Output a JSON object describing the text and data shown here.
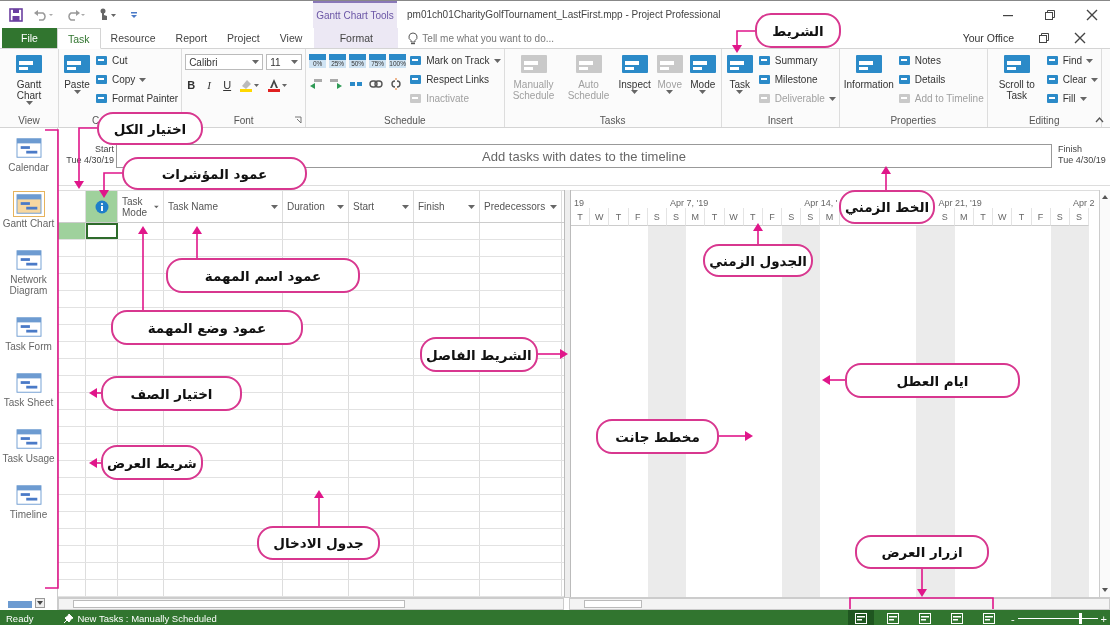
{
  "title_bar": {
    "contextual_group": "Gantt Chart Tools",
    "title": "pm01ch01CharityGolfTournament_LastFirst.mpp - Project Professional"
  },
  "tabs": [
    {
      "label": "File",
      "kind": "file",
      "selected": false
    },
    {
      "label": "Task",
      "kind": "tab",
      "selected": true
    },
    {
      "label": "Resource",
      "kind": "tab",
      "selected": false
    },
    {
      "label": "Report",
      "kind": "tab",
      "selected": false
    },
    {
      "label": "Project",
      "kind": "tab",
      "selected": false
    },
    {
      "label": "View",
      "kind": "tab",
      "selected": false
    },
    {
      "label": "Format",
      "kind": "contextual",
      "selected": false
    }
  ],
  "tell_me": {
    "placeholder": "Tell me what you want to do..."
  },
  "account": "Your Office",
  "ribbon": {
    "groups": [
      {
        "label": "View",
        "items": [
          {
            "kind": "large",
            "label": "Gantt Chart",
            "dropdown": true,
            "disabled": false
          }
        ]
      },
      {
        "label": "C",
        "items": [
          {
            "kind": "large",
            "label": "Paste",
            "dropdown": true,
            "disabled": false
          },
          {
            "kind": "small",
            "label": "Cut",
            "dropdown": false,
            "disabled": false
          },
          {
            "kind": "small",
            "label": "Copy",
            "dropdown": true,
            "disabled": false
          },
          {
            "kind": "small",
            "label": "Format Painter",
            "dropdown": false,
            "disabled": false
          }
        ]
      },
      {
        "label": "Font",
        "launcher": true,
        "items": [
          {
            "kind": "font",
            "font_name": "Calibri",
            "font_size": "11",
            "styles": [
              "B",
              "I",
              "U"
            ]
          }
        ]
      },
      {
        "label": "Schedule",
        "items": [
          {
            "kind": "percents",
            "labels": [
              "0%",
              "25%",
              "50%",
              "75%",
              "100%"
            ]
          },
          {
            "kind": "small",
            "label": "Mark on Track",
            "dropdown": true,
            "disabled": false
          },
          {
            "kind": "small",
            "label": "Respect Links",
            "dropdown": false,
            "disabled": false
          },
          {
            "kind": "small",
            "label": "Inactivate",
            "dropdown": false,
            "disabled": true
          }
        ]
      },
      {
        "label": "Tasks",
        "items": [
          {
            "kind": "large",
            "label": "Manually Schedule",
            "dropdown": false,
            "disabled": true
          },
          {
            "kind": "large",
            "label": "Auto Schedule",
            "dropdown": false,
            "disabled": true
          },
          {
            "kind": "large",
            "label": "Inspect",
            "dropdown": true,
            "disabled": false
          },
          {
            "kind": "large",
            "label": "Move",
            "dropdown": true,
            "disabled": true
          },
          {
            "kind": "large",
            "label": "Mode",
            "dropdown": true,
            "disabled": false
          }
        ]
      },
      {
        "label": "Insert",
        "items": [
          {
            "kind": "large",
            "label": "Task",
            "dropdown": true,
            "disabled": false
          },
          {
            "kind": "small",
            "label": "Summary",
            "dropdown": false,
            "disabled": false
          },
          {
            "kind": "small",
            "label": "Milestone",
            "dropdown": false,
            "disabled": false
          },
          {
            "kind": "small",
            "label": "Deliverable",
            "dropdown": true,
            "disabled": true
          }
        ]
      },
      {
        "label": "Properties",
        "items": [
          {
            "kind": "large",
            "label": "Information",
            "dropdown": false,
            "disabled": false
          },
          {
            "kind": "small",
            "label": "Notes",
            "dropdown": false,
            "disabled": false
          },
          {
            "kind": "small",
            "label": "Details",
            "dropdown": false,
            "disabled": false
          },
          {
            "kind": "small",
            "label": "Add to Timeline",
            "dropdown": false,
            "disabled": true
          }
        ]
      },
      {
        "label": "Editing",
        "items": [
          {
            "kind": "large",
            "label": "Scroll to Task",
            "dropdown": false,
            "disabled": false
          },
          {
            "kind": "small",
            "label": "Find",
            "dropdown": true,
            "disabled": false
          },
          {
            "kind": "small",
            "label": "Clear",
            "dropdown": true,
            "disabled": false
          },
          {
            "kind": "small",
            "label": "Fill",
            "dropdown": true,
            "disabled": false
          }
        ]
      }
    ]
  },
  "view_bar": [
    {
      "label": "Calendar",
      "selected": false
    },
    {
      "label": "Gantt Chart",
      "selected": true
    },
    {
      "label": "Network Diagram",
      "selected": false
    },
    {
      "label": "Task Form",
      "selected": false
    },
    {
      "label": "Task Sheet",
      "selected": false
    },
    {
      "label": "Task Usage",
      "selected": false
    },
    {
      "label": "Timeline",
      "selected": false
    }
  ],
  "timeline": {
    "start_label": "Start",
    "start_date": "Tue 4/30/19",
    "prompt": "Add tasks with dates to the timeline",
    "finish_label": "Finish",
    "finish_date": "Tue 4/30/19"
  },
  "table": {
    "columns": [
      {
        "kind": "indicators",
        "selected": true
      },
      {
        "kind": "text",
        "label": "Task Mode",
        "selected": false
      },
      {
        "kind": "text",
        "label": "Task Name",
        "selected": false
      },
      {
        "kind": "text",
        "label": "Duration",
        "selected": false
      },
      {
        "kind": "text",
        "label": "Start",
        "selected": false
      },
      {
        "kind": "text",
        "label": "Finish",
        "selected": false
      },
      {
        "kind": "text",
        "label": "Predecessors",
        "selected": false
      }
    ],
    "rows": [
      {
        "selected": true
      },
      {
        "selected": false
      },
      {
        "selected": false
      },
      {
        "selected": false
      },
      {
        "selected": false
      },
      {
        "selected": false
      },
      {
        "selected": false
      },
      {
        "selected": false
      },
      {
        "selected": false
      },
      {
        "selected": false
      },
      {
        "selected": false
      },
      {
        "selected": false
      },
      {
        "selected": false
      },
      {
        "selected": false
      },
      {
        "selected": false
      },
      {
        "selected": false
      },
      {
        "selected": false
      },
      {
        "selected": false
      },
      {
        "selected": false
      },
      {
        "selected": false
      },
      {
        "selected": false
      },
      {
        "selected": false
      }
    ]
  },
  "gantt": {
    "weeks": [
      {
        "label": "19",
        "days": [
          {
            "label": "T",
            "nonworking": false
          },
          {
            "label": "W",
            "nonworking": false
          },
          {
            "label": "T",
            "nonworking": false
          },
          {
            "label": "F",
            "nonworking": false
          },
          {
            "label": "S",
            "nonworking": true
          }
        ]
      },
      {
        "label": "Apr 7, '19",
        "days": [
          {
            "label": "S",
            "nonworking": true
          },
          {
            "label": "M",
            "nonworking": false
          },
          {
            "label": "T",
            "nonworking": false
          },
          {
            "label": "W",
            "nonworking": false
          },
          {
            "label": "T",
            "nonworking": false
          },
          {
            "label": "F",
            "nonworking": false
          },
          {
            "label": "S",
            "nonworking": true
          }
        ]
      },
      {
        "label": "Apr 14, '",
        "days": [
          {
            "label": "S",
            "nonworking": true
          },
          {
            "label": "M",
            "nonworking": false
          },
          {
            "nonworking": false
          },
          {
            "nonworking": false
          },
          {
            "nonworking": false
          },
          {
            "nonworking": false
          },
          {
            "nonworking": true
          }
        ]
      },
      {
        "label": "Apr 21, '19",
        "days": [
          {
            "label": "S",
            "nonworking": true
          },
          {
            "label": "M",
            "nonworking": false
          },
          {
            "label": "T",
            "nonworking": false
          },
          {
            "label": "W",
            "nonworking": false
          },
          {
            "label": "T",
            "nonworking": false
          },
          {
            "label": "F",
            "nonworking": false
          },
          {
            "label": "S",
            "nonworking": true
          }
        ]
      },
      {
        "label": "Apr 2",
        "days": [
          {
            "label": "S",
            "nonworking": true
          }
        ]
      }
    ]
  },
  "status_bar": {
    "state": "Ready",
    "new_tasks": "New Tasks : Manually Scheduled",
    "views": [
      {
        "selected": true
      },
      {
        "selected": false
      },
      {
        "selected": false
      },
      {
        "selected": false
      },
      {
        "selected": false
      }
    ],
    "zoom": {
      "minus": "-",
      "plus": "+",
      "level": 0.78
    }
  },
  "callouts": [
    "الشريط",
    "اختيار الكل",
    "عمود المؤشرات",
    "الخط الزمني",
    "الجدول الزمني",
    "عمود اسم المهمة",
    "عمود وضع المهمة",
    "الشريط الفاصل",
    "ايام العطل",
    "اختيار الصف",
    "مخطط جانت",
    "شريط العرض",
    "جدول الادخال",
    "ازرار العرض"
  ]
}
